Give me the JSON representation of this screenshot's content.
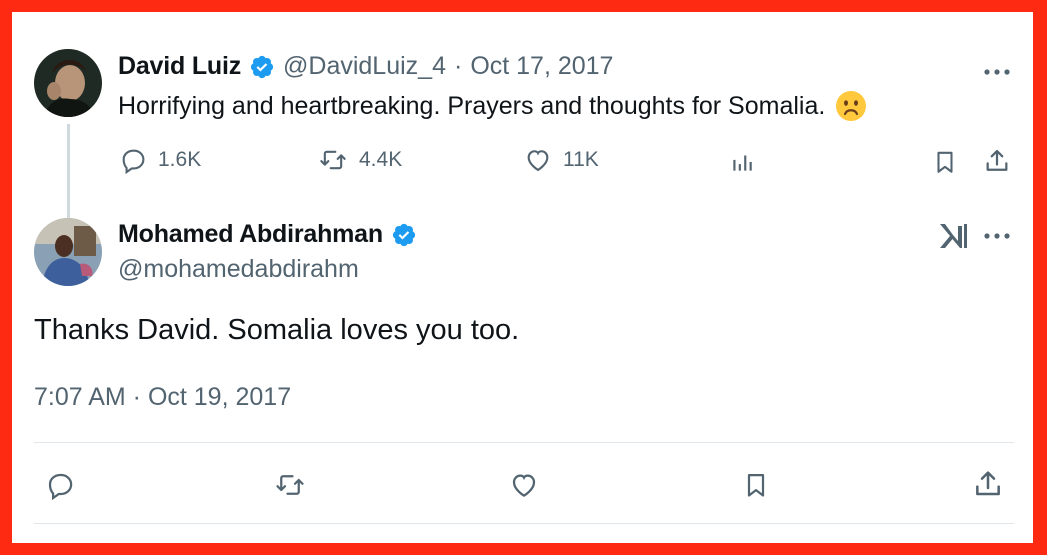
{
  "quoted_tweet": {
    "author_name": "David Luiz",
    "handle": "@DavidLuiz_4",
    "separator": "·",
    "date": "Oct 17, 2017",
    "text": "Horrifying and heartbreaking. Prayers and thoughts for Somalia.",
    "emoji": "☹️",
    "stats": {
      "replies": "1.6K",
      "retweets": "4.4K",
      "likes": "11K"
    }
  },
  "main_tweet": {
    "author_name": "Mohamed Abdirahman",
    "handle": "@mohamedabdirahm",
    "text": "Thanks David. Somalia loves you too.",
    "timestamp": "7:07 AM · Oct 19, 2017"
  },
  "colors": {
    "border": "#ff2a12",
    "verified_blue": "#1d9bf0",
    "muted_text": "#536471",
    "divider": "#e1e6ea"
  },
  "icons": [
    "more-icon",
    "verified-icon",
    "reply-icon",
    "retweet-icon",
    "like-icon",
    "analytics-icon",
    "bookmark-icon",
    "share-icon",
    "grok-icon"
  ]
}
